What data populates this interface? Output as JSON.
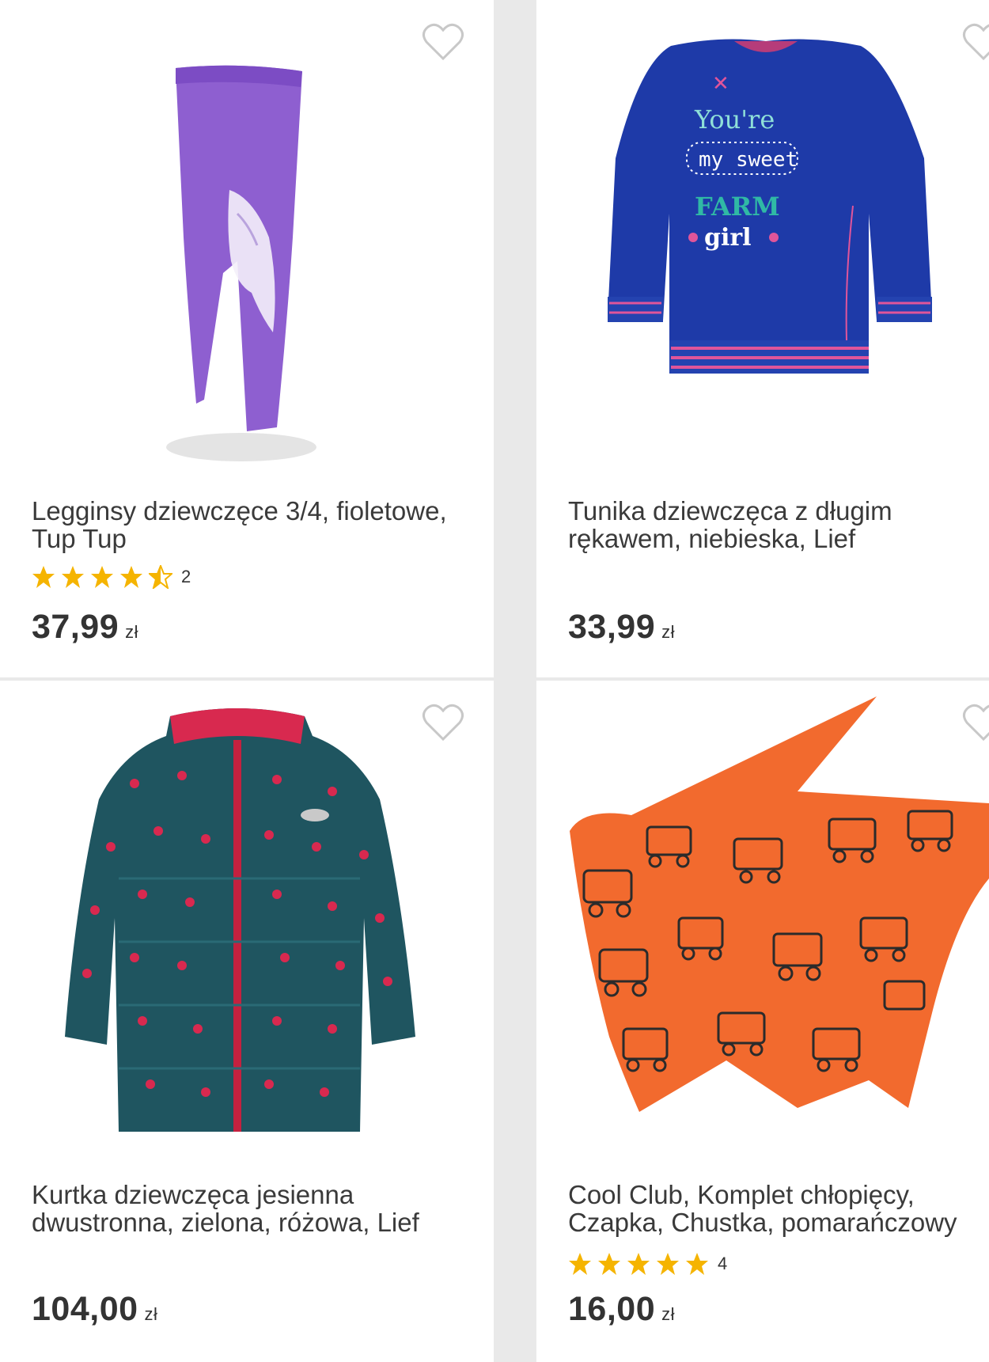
{
  "colors": {
    "star": "#f5b400",
    "heart": "#c8c8c8",
    "divider": "#e9e9e9"
  },
  "products": [
    {
      "name": "Legginsy dziewczęce 3/4, fioletowe, Tup Tup",
      "price": "37,99",
      "currency": "zł",
      "rating": 4.5,
      "review_count": "2",
      "image": "purple leggings with horse print"
    },
    {
      "name": "Tunika dziewczęca z długim rękawem, niebieska, Lief",
      "price": "33,99",
      "currency": "zł",
      "image": "blue tunic with print",
      "image_text": [
        "You're",
        "my sweet",
        "FARM",
        "girl"
      ]
    },
    {
      "name": "Kurtka dziewczęca jesienna dwustronna, zielona, różowa, Lief",
      "price": "104,00",
      "currency": "zł",
      "image": "green polka dot jacket"
    },
    {
      "name": "Cool Club, Komplet chłopięcy, Czapka, Chustka, pomarańczowy",
      "price": "16,00",
      "currency": "zł",
      "rating": 5,
      "review_count": "4",
      "image": "orange hat and scarf set with excavator print"
    }
  ]
}
